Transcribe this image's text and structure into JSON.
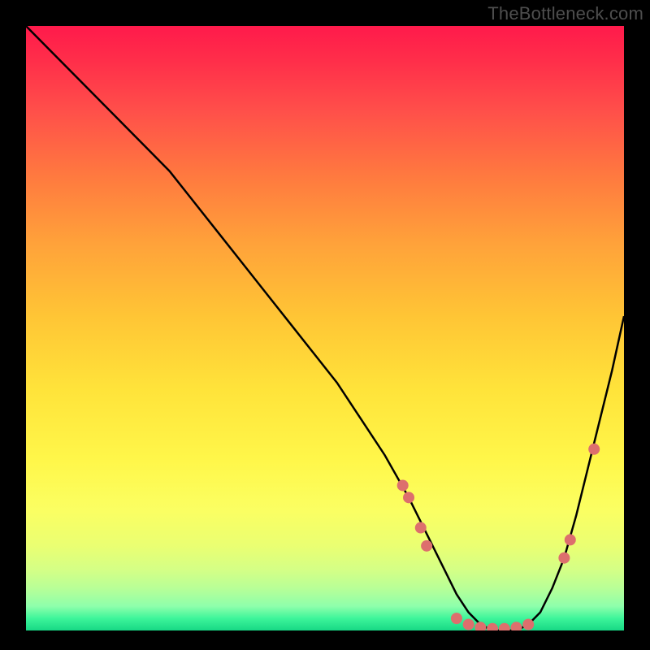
{
  "watermark": "TheBottleneck.com",
  "chart_data": {
    "type": "line",
    "title": "",
    "xlabel": "",
    "ylabel": "",
    "xlim": [
      0,
      100
    ],
    "ylim": [
      0,
      100
    ],
    "series": [
      {
        "name": "bottleneck-curve",
        "x": [
          0,
          4,
          8,
          12,
          16,
          20,
          24,
          28,
          32,
          36,
          40,
          44,
          48,
          52,
          56,
          60,
          64,
          66,
          68,
          70,
          72,
          74,
          76,
          78,
          80,
          82,
          84,
          86,
          88,
          90,
          92,
          94,
          96,
          98,
          100
        ],
        "y": [
          100,
          96,
          92,
          88,
          84,
          80,
          76,
          71,
          66,
          61,
          56,
          51,
          46,
          41,
          35,
          29,
          22,
          18,
          14,
          10,
          6,
          3,
          1,
          0,
          0,
          0,
          1,
          3,
          7,
          12,
          19,
          27,
          35,
          43,
          52
        ]
      }
    ],
    "markers": {
      "name": "marker-dots",
      "points": [
        {
          "x": 63,
          "y": 24
        },
        {
          "x": 64,
          "y": 22
        },
        {
          "x": 66,
          "y": 17
        },
        {
          "x": 67,
          "y": 14
        },
        {
          "x": 72,
          "y": 2
        },
        {
          "x": 74,
          "y": 1
        },
        {
          "x": 76,
          "y": 0.5
        },
        {
          "x": 78,
          "y": 0.3
        },
        {
          "x": 80,
          "y": 0.3
        },
        {
          "x": 82,
          "y": 0.5
        },
        {
          "x": 84,
          "y": 1
        },
        {
          "x": 90,
          "y": 12
        },
        {
          "x": 91,
          "y": 15
        },
        {
          "x": 95,
          "y": 30
        }
      ],
      "color": "#dd6f6d"
    },
    "colors": {
      "curve": "#000000",
      "marker": "#dd6f6d",
      "background_top": "#ff1a4b",
      "background_bottom": "#17d885"
    }
  }
}
